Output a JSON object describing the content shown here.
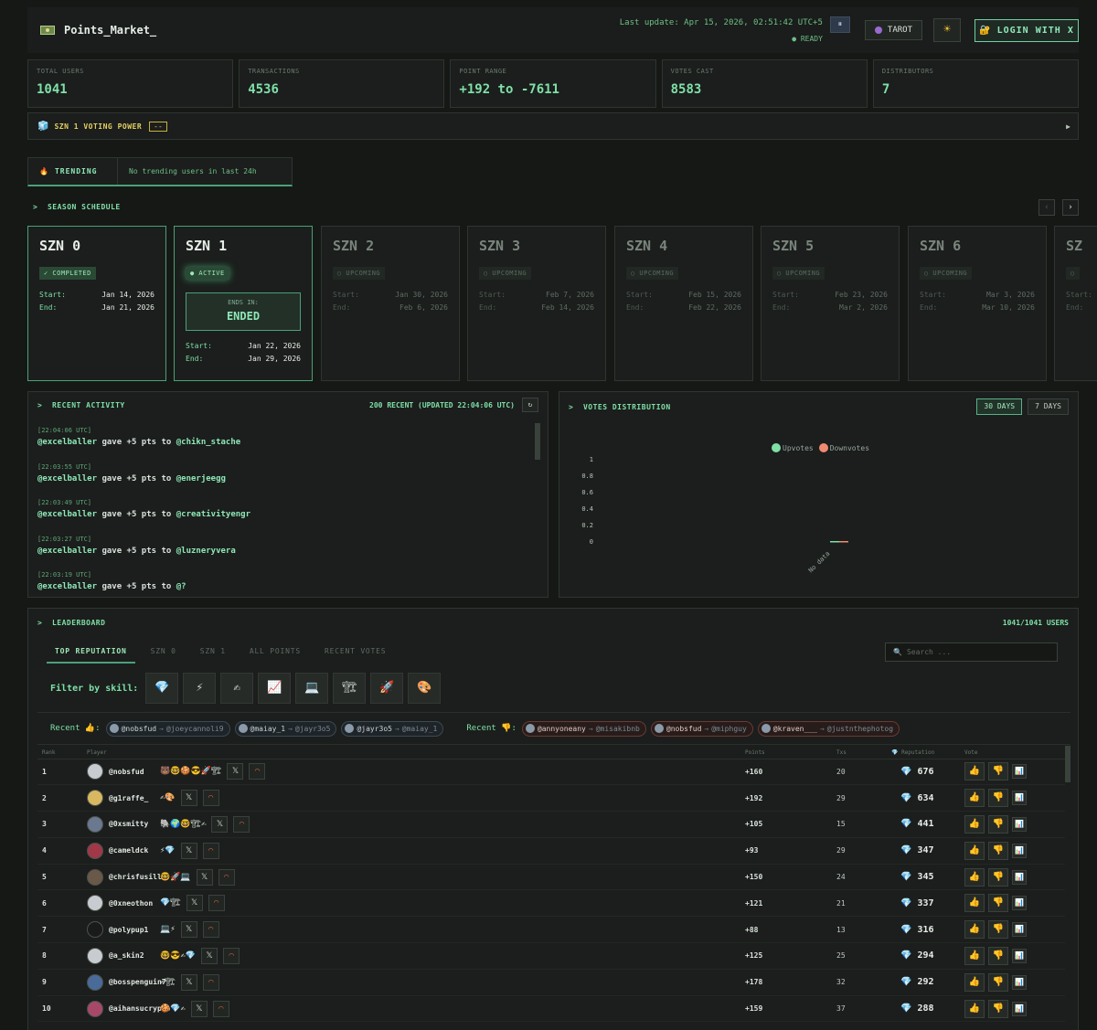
{
  "header": {
    "app_name": "Points_Market_",
    "last_update": "Last update: Apr 15, 2026, 02:51:42 UTC+5",
    "status": "● READY",
    "pause_icon": "⏸",
    "tarot_label": "TAROT",
    "theme_icon": "☀",
    "login_label": "LOGIN WITH X"
  },
  "stats": [
    {
      "label": "TOTAL USERS",
      "value": "1041"
    },
    {
      "label": "TRANSACTIONS",
      "value": "4536"
    },
    {
      "label": "POINT RANGE",
      "value": "+192 to -7611"
    },
    {
      "label": "VOTES CAST",
      "value": "8583"
    },
    {
      "label": "DISTRIBUTORS",
      "value": "7"
    }
  ],
  "voting_power": {
    "label": "SZN 1 VOTING POWER",
    "tag": "--",
    "arrow": "▶"
  },
  "trending": {
    "tab_label": "TRENDING",
    "message": "No trending users in last 24h"
  },
  "season_schedule": {
    "title": "SEASON SCHEDULE",
    "prev": "‹",
    "next": "›",
    "start_label": "Start:",
    "end_label": "End:",
    "ends_in_label": "ENDS IN:",
    "ends_in_value": "ENDED",
    "seasons": [
      {
        "name": "SZN 0",
        "status": "✓ COMPLETED",
        "start": "Jan 14, 2026",
        "end": "Jan 21, 2026"
      },
      {
        "name": "SZN 1",
        "status": "● ACTIVE",
        "start": "Jan 22, 2026",
        "end": "Jan 29, 2026"
      },
      {
        "name": "SZN 2",
        "status": "○ UPCOMING",
        "start": "Jan 30, 2026",
        "end": "Feb 6, 2026"
      },
      {
        "name": "SZN 3",
        "status": "○ UPCOMING",
        "start": "Feb 7, 2026",
        "end": "Feb 14, 2026"
      },
      {
        "name": "SZN 4",
        "status": "○ UPCOMING",
        "start": "Feb 15, 2026",
        "end": "Feb 22, 2026"
      },
      {
        "name": "SZN 5",
        "status": "○ UPCOMING",
        "start": "Feb 23, 2026",
        "end": "Mar 2, 2026"
      },
      {
        "name": "SZN 6",
        "status": "○ UPCOMING",
        "start": "Mar 3, 2026",
        "end": "Mar 10, 2026"
      },
      {
        "name": "SZ",
        "status": "○",
        "start": "",
        "end": ""
      }
    ]
  },
  "activity": {
    "title": "RECENT ACTIVITY",
    "count_label": "200 RECENT (UPDATED 22:04:06 UTC)",
    "refresh_icon": "↻",
    "items": [
      {
        "time": "[22:04:06 UTC]",
        "giver": "@excelballer",
        "action": "gave +5 pts to",
        "receiver": "@chikn_stache"
      },
      {
        "time": "[22:03:55 UTC]",
        "giver": "@excelballer",
        "action": "gave +5 pts to",
        "receiver": "@enerjeegg"
      },
      {
        "time": "[22:03:49 UTC]",
        "giver": "@excelballer",
        "action": "gave +5 pts to",
        "receiver": "@creativityengr"
      },
      {
        "time": "[22:03:27 UTC]",
        "giver": "@excelballer",
        "action": "gave +5 pts to",
        "receiver": "@luzneryvera"
      },
      {
        "time": "[22:03:19 UTC]",
        "giver": "@excelballer",
        "action": "gave +5 pts to",
        "receiver": "@?"
      }
    ]
  },
  "votes_distribution": {
    "title": "VOTES DISTRIBUTION",
    "range_30": "30 DAYS",
    "range_7": "7 DAYS",
    "legend_up": "Upvotes",
    "legend_down": "Downvotes",
    "color_up": "#7fe0a8",
    "color_down": "#f08a70",
    "no_data": "No data"
  },
  "chart_data": {
    "type": "bar",
    "categories": [
      "No data"
    ],
    "series": [
      {
        "name": "Upvotes",
        "values": [
          0
        ]
      },
      {
        "name": "Downvotes",
        "values": [
          0
        ]
      }
    ],
    "yticks": [
      "1",
      "0.8",
      "0.6",
      "0.4",
      "0.2",
      "0"
    ],
    "ylim": [
      0,
      1
    ],
    "legend": "top"
  },
  "leaderboard": {
    "title": "LEADERBOARD",
    "count": "1041/1041 USERS",
    "tabs": [
      "TOP REPUTATION",
      "SZN 0",
      "SZN 1",
      "ALL POINTS",
      "RECENT VOTES"
    ],
    "search_placeholder": "Search ...",
    "search_icon": "🔍",
    "filter_label": "Filter by skill:",
    "skills": [
      "💎",
      "⚡",
      "✍",
      "📈",
      "💻",
      "🏗",
      "🚀",
      "🎨"
    ],
    "recent_up_label": "Recent 👍:",
    "recent_down_label": "Recent 👎:",
    "recent_up": [
      {
        "from": "@nobsfud",
        "to": "@joeycannoli9"
      },
      {
        "from": "@maiay_1",
        "to": "@jayr3o5"
      },
      {
        "from": "@jayr3o5",
        "to": "@maiay_1"
      }
    ],
    "recent_down": [
      {
        "from": "@annyoneany",
        "to": "@misakibnb"
      },
      {
        "from": "@nobsfud",
        "to": "@miphguy"
      },
      {
        "from": "@kraven___",
        "to": "@justnthephotog"
      }
    ],
    "columns": [
      "Rank",
      "Player",
      "Points",
      "Txs",
      "💎 Reputation",
      "Vote"
    ],
    "x_icon": "𝕏",
    "o_icon": "◠",
    "vote_up_icon": "👍",
    "vote_down_icon": "👎",
    "vote_chart_icon": "📊",
    "gem_icon": "💎",
    "rows": [
      {
        "rank": "1",
        "name": "@nobsfud",
        "skills": "🐻🤓🍪😎🚀🏗",
        "points": "+160",
        "txs": "20",
        "rep": "676",
        "avatar": "#c8ccd0"
      },
      {
        "rank": "2",
        "name": "@g1raffe_",
        "skills": "✍🎨",
        "points": "+192",
        "txs": "29",
        "rep": "634",
        "avatar": "#d8b860"
      },
      {
        "rank": "3",
        "name": "@0xsmitty",
        "skills": "🐘🌍🤓🏗✍",
        "points": "+105",
        "txs": "15",
        "rep": "441",
        "avatar": "#6a7890"
      },
      {
        "rank": "4",
        "name": "@cameldck",
        "skills": "⚡💎",
        "points": "+93",
        "txs": "29",
        "rep": "347",
        "avatar": "#a03848"
      },
      {
        "rank": "5",
        "name": "@chrisfusillo",
        "skills": "🤓🚀💻",
        "points": "+150",
        "txs": "24",
        "rep": "345",
        "avatar": "#6a5848"
      },
      {
        "rank": "6",
        "name": "@0xneothon",
        "skills": "💎🏗",
        "points": "+121",
        "txs": "21",
        "rep": "337",
        "avatar": "#c8ccd0"
      },
      {
        "rank": "7",
        "name": "@polypup1",
        "skills": "💻⚡",
        "points": "+88",
        "txs": "13",
        "rep": "316",
        "avatar": "#1a1a1a"
      },
      {
        "rank": "8",
        "name": "@a_skin2",
        "skills": "🤓😎✍💎",
        "points": "+125",
        "txs": "25",
        "rep": "294",
        "avatar": "#c8ccd0"
      },
      {
        "rank": "9",
        "name": "@bosspenguin7",
        "skills": "✍🏗",
        "points": "+178",
        "txs": "32",
        "rep": "292",
        "avatar": "#4a6a9a"
      },
      {
        "rank": "10",
        "name": "@aihansucrypto",
        "skills": "🍪💎✍",
        "points": "+159",
        "txs": "37",
        "rep": "288",
        "avatar": "#a84868"
      }
    ]
  }
}
